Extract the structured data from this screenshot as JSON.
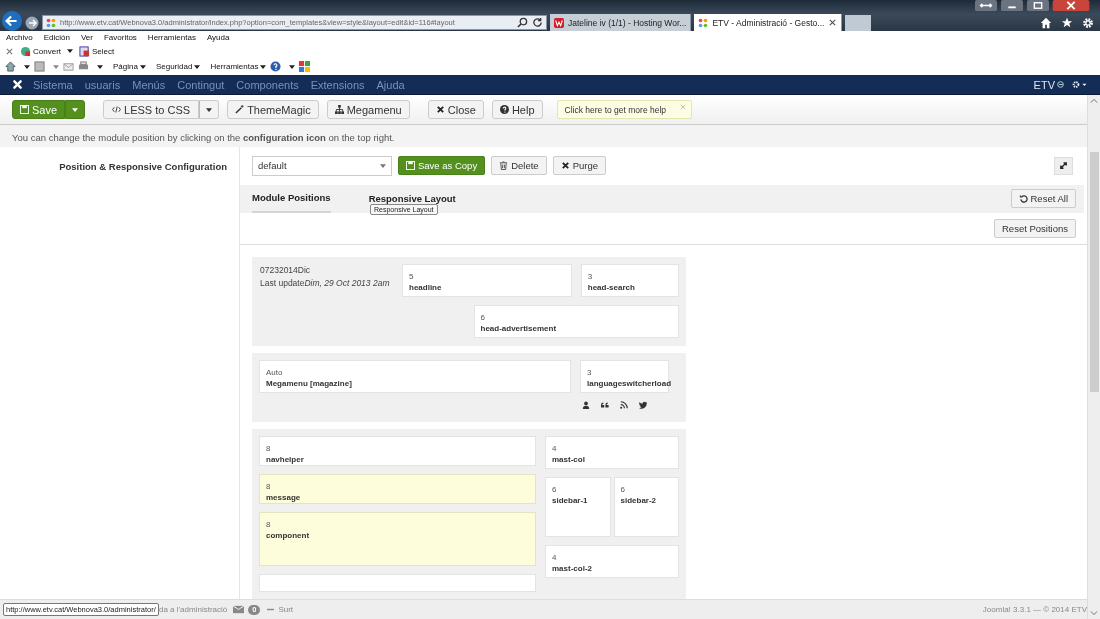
{
  "browser": {
    "url": "http://www.etv.cat/Webnova3.0/administrator/index.php?option=com_templates&view=style&layout=edit&id=116#layout",
    "tabs": [
      {
        "title": "Jateline iv (1/1) - Hosting Wor...",
        "selected": false
      },
      {
        "title": "ETV - Administració - Gesto...",
        "selected": true
      }
    ],
    "menu": [
      "Archivo",
      "Edición",
      "Ver",
      "Favoritos",
      "Herramientas",
      "Ayuda"
    ],
    "addons": [
      "Convert",
      "Select"
    ],
    "commands": [
      "Página",
      "Seguridad",
      "Herramientas"
    ]
  },
  "admin_menu": {
    "items": [
      "Sistema",
      "usuaris",
      "Menús",
      "Contingut",
      "Components",
      "Extensions",
      "Ajuda"
    ],
    "user": "ETV"
  },
  "toolbar": {
    "buttons": [
      {
        "label": "Save",
        "kind": "save"
      },
      {
        "label": "LESS to CSS",
        "kind": "less"
      },
      {
        "label": "ThemeMagic",
        "kind": "magic"
      },
      {
        "label": "Megamenu",
        "kind": "megamenu"
      },
      {
        "label": "Close",
        "kind": "close"
      },
      {
        "label": "Help",
        "kind": "help"
      }
    ],
    "tip": "Click here to get more help"
  },
  "notice": "You can change the module position by clicking on the **configuration icon** on the top right.",
  "config": {
    "label": "Position & Responsive Configuration",
    "layout": "default",
    "buttons": [
      {
        "label": "Save as Copy",
        "kind": "copy"
      },
      {
        "label": "Delete",
        "kind": "delete"
      },
      {
        "label": "Purge",
        "kind": "purge"
      }
    ]
  },
  "tabs": [
    {
      "label": "Module Positions",
      "selected": true
    },
    {
      "label": "Responsive Layout",
      "selected": false
    }
  ],
  "tab_tooltip": "Responsive Layout",
  "reset_all": "Reset All",
  "reset_positions": "Reset Positions",
  "header_block": {
    "code": "07232014Dic",
    "update_label": "Last update",
    "update_date": "Dim, 29 Oct 2013 2am",
    "positions": [
      {
        "span": "5",
        "name": "headline",
        "highlighted": false
      },
      {
        "span": "3",
        "name": "head-search",
        "highlighted": false
      },
      {
        "span": "6",
        "name": "head-advertisement",
        "highlighted": false
      }
    ]
  },
  "menu_block": {
    "positions": [
      {
        "span": "Auto",
        "name": "Megamenu [magazine]",
        "highlighted": false
      },
      {
        "span": "3",
        "name": "languageswitcherload",
        "highlighted": false
      }
    ]
  },
  "main_block": {
    "left": [
      {
        "span": "8",
        "name": "navhelper",
        "highlighted": false
      },
      {
        "span": "8",
        "name": "message",
        "highlighted": true
      },
      {
        "span": "8",
        "name": "component",
        "highlighted": true
      }
    ],
    "right": [
      {
        "span": "4",
        "name": "mast-col",
        "highlighted": false
      },
      {
        "span": "6",
        "name": "sidebar-1",
        "highlighted": false
      },
      {
        "span": "6",
        "name": "sidebar-2",
        "highlighted": false
      },
      {
        "span": "4",
        "name": "mast-col-2",
        "highlighted": false
      }
    ]
  },
  "status_bar": {
    "link_preview": "http://www.etv.cat/Webnova3.0/administrator/",
    "admin_link": "da a l'administració",
    "messages": "0",
    "logout": "Surt",
    "version": "Joomla! 3.3.1 — © 2014 ETV"
  }
}
